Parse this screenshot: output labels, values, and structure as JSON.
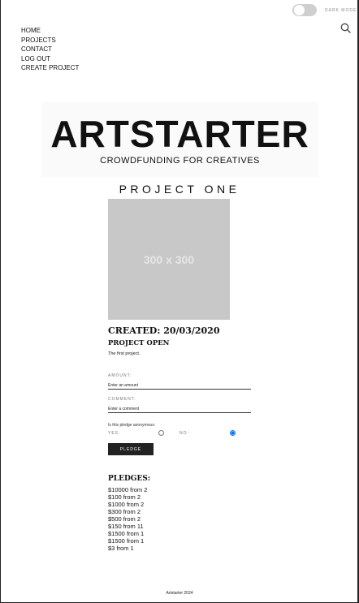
{
  "header": {
    "theme_toggle_label": "DARK MODE",
    "theme_toggle_on": false
  },
  "nav": {
    "items": [
      {
        "label": "HOME"
      },
      {
        "label": "PROJECTS"
      },
      {
        "label": "CONTACT"
      },
      {
        "label": "LOG OUT"
      },
      {
        "label": "CREATE PROJECT"
      }
    ]
  },
  "logo": {
    "title": "ARTSTARTER",
    "tagline": "CROWDFUNDING FOR CREATIVES"
  },
  "project": {
    "title": "PROJECT ONE",
    "image_placeholder": "300 x 300",
    "created": "CREATED: 20/03/2020",
    "status": "PROJECT OPEN",
    "description": "The first project."
  },
  "form": {
    "amount_label": "AMOUNT:",
    "amount_placeholder": "Enter an amount",
    "comment_label": "COMMENT:",
    "comment_placeholder": "Enter a comment",
    "anonymous_question": "Is this pledge anonymous:",
    "yes_label": "YES:",
    "no_label": "NO:",
    "selected": "no",
    "submit_label": "PLEDGE"
  },
  "pledges": {
    "heading": "PLEDGES:",
    "items": [
      "$10000 from 2",
      "$100 from 2",
      "$1000 from 2",
      "$300 from 2",
      "$500 from 2",
      "$150 from 11",
      "$1500 from 1",
      "$1500 from 1",
      "$3 from 1"
    ]
  },
  "footer": {
    "text": "Artstarter 2024"
  },
  "colors": {
    "accent": "#222222",
    "toggle_track": "#cfcfcf",
    "image_placeholder_bg": "#c8c8c8",
    "radio_selected": "#1a73e8"
  },
  "icons": {
    "search": "search-icon"
  }
}
